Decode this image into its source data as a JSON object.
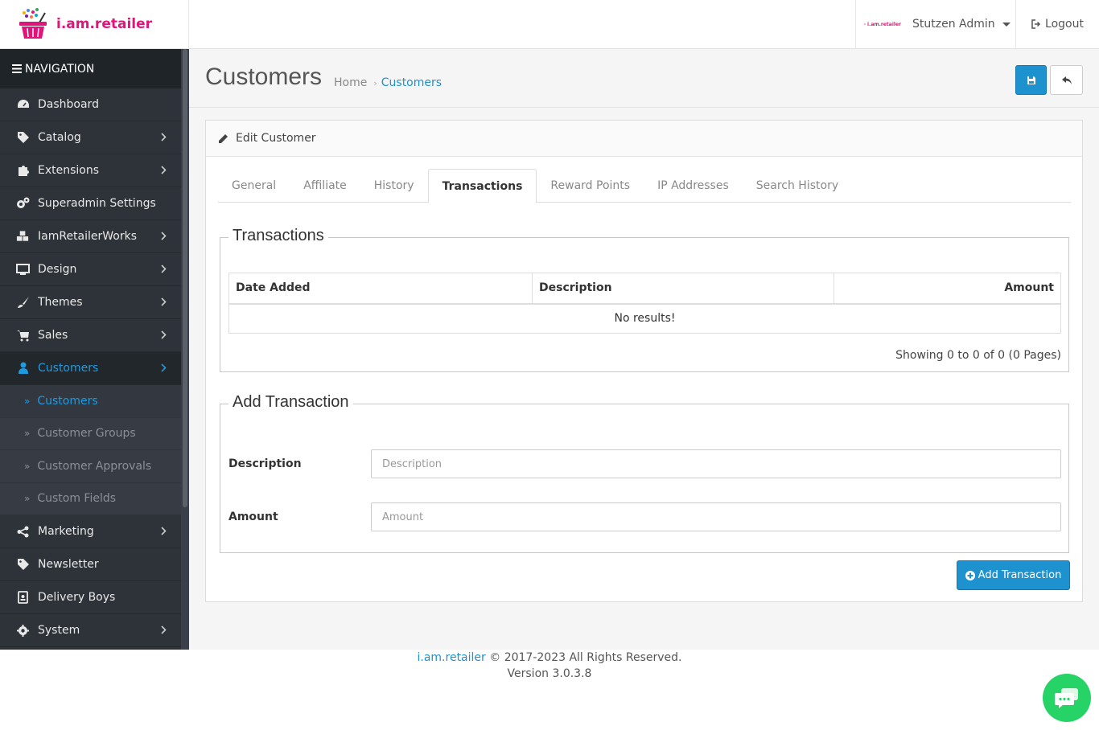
{
  "brand": {
    "name": "i.am.retailer",
    "small_logo_text": "i.am.retailer"
  },
  "header": {
    "user_name": "Stutzen Admin",
    "logout_label": "Logout"
  },
  "nav": {
    "heading": "NAVIGATION",
    "items": [
      {
        "label": "Dashboard",
        "icon": "dashboard-icon"
      },
      {
        "label": "Catalog",
        "icon": "tags-icon"
      },
      {
        "label": "Extensions",
        "icon": "puzzle-icon"
      },
      {
        "label": "Superadmin Settings",
        "icon": "cogs-icon"
      },
      {
        "label": "IamRetailerWorks",
        "icon": "cubes-icon"
      },
      {
        "label": "Design",
        "icon": "desktop-icon"
      },
      {
        "label": "Themes",
        "icon": "brush-icon"
      },
      {
        "label": "Sales",
        "icon": "cart-icon"
      },
      {
        "label": "Customers",
        "icon": "user-icon"
      },
      {
        "label": "Marketing",
        "icon": "share-icon"
      },
      {
        "label": "Newsletter",
        "icon": "tags-icon"
      },
      {
        "label": "Delivery Boys",
        "icon": "id-badge-icon"
      },
      {
        "label": "System",
        "icon": "cog-icon"
      }
    ],
    "sub_items": [
      "Customers",
      "Customer Groups",
      "Customer Approvals",
      "Custom Fields"
    ]
  },
  "page": {
    "title": "Customers",
    "breadcrumb": [
      "Home",
      "Customers"
    ]
  },
  "panel": {
    "heading": "Edit Customer",
    "tabs": [
      "General",
      "Affiliate",
      "History",
      "Transactions",
      "Reward Points",
      "IP Addresses",
      "Search History"
    ],
    "active_tab": "Transactions"
  },
  "transactions": {
    "legend": "Transactions",
    "columns": [
      "Date Added",
      "Description",
      "Amount"
    ],
    "empty_text": "No results!",
    "showing": "Showing 0 to 0 of 0 (0 Pages)"
  },
  "add_transaction": {
    "legend": "Add Transaction",
    "description_label": "Description",
    "description_placeholder": "Description",
    "amount_label": "Amount",
    "amount_placeholder": "Amount",
    "button_label": "Add Transaction"
  },
  "footer": {
    "brand_link": "i.am.retailer",
    "copyright": "© 2017-2023 All Rights Reserved.",
    "version": "Version 3.0.3.8"
  },
  "colors": {
    "accent": "#1e91cf",
    "brand": "#e0147a",
    "sidebar": "#2d3339",
    "chat": "#25d366"
  }
}
